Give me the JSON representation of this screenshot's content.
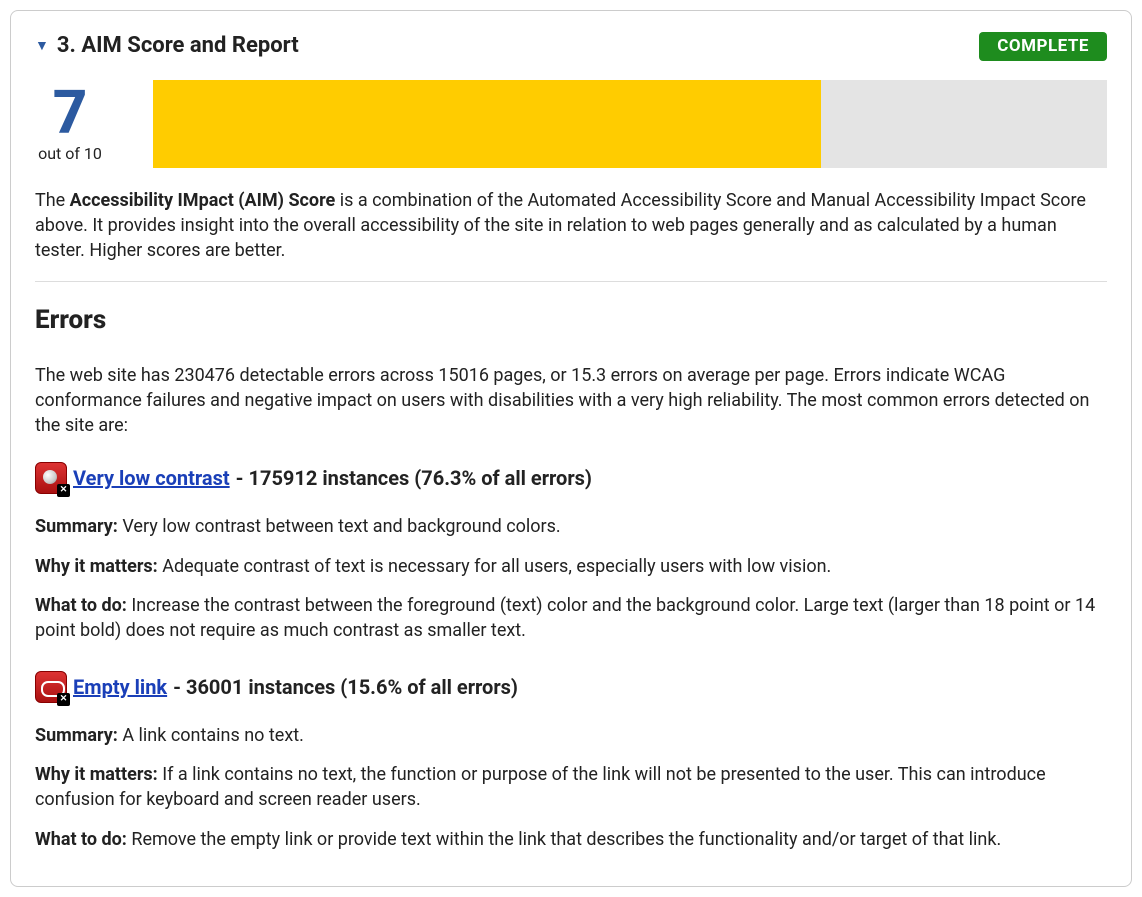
{
  "section": {
    "title": "3. AIM Score and Report",
    "status": "COMPLETE"
  },
  "score": {
    "value": "7",
    "subtext": "out of 10",
    "percent": 70
  },
  "description": {
    "prefix": "The ",
    "bold": "Accessibility IMpact (AIM) Score",
    "rest": " is a combination of the Automated Accessibility Score and Manual Accessibility Impact Score above. It provides insight into the overall accessibility of the site in relation to web pages generally and as calculated by a human tester. Higher scores are better."
  },
  "errors_heading": "Errors",
  "errors_intro": "The web site has 230476 detectable errors across 15016 pages, or 15.3 errors on average per page. Errors indicate WCAG conformance failures and negative impact on users with disabilities with a very high reliability. The most common errors detected on the site are:",
  "errors": [
    {
      "name": "Very low contrast",
      "stats": " - 175912 instances (76.3% of all errors)",
      "summary_label": "Summary:",
      "summary": " Very low contrast between text and background colors.",
      "why_label": "Why it matters:",
      "why": " Adequate contrast of text is necessary for all users, especially users with low vision.",
      "what_label": "What to do:",
      "what": " Increase the contrast between the foreground (text) color and the background color. Large text (larger than 18 point or 14 point bold) does not require as much contrast as smaller text."
    },
    {
      "name": "Empty link",
      "stats": " - 36001 instances (15.6% of all errors)",
      "summary_label": "Summary:",
      "summary": " A link contains no text.",
      "why_label": "Why it matters:",
      "why": " If a link contains no text, the function or purpose of the link will not be presented to the user. This can introduce confusion for keyboard and screen reader users.",
      "what_label": "What to do:",
      "what": " Remove the empty link or provide text within the link that describes the functionality and/or target of that link."
    }
  ]
}
